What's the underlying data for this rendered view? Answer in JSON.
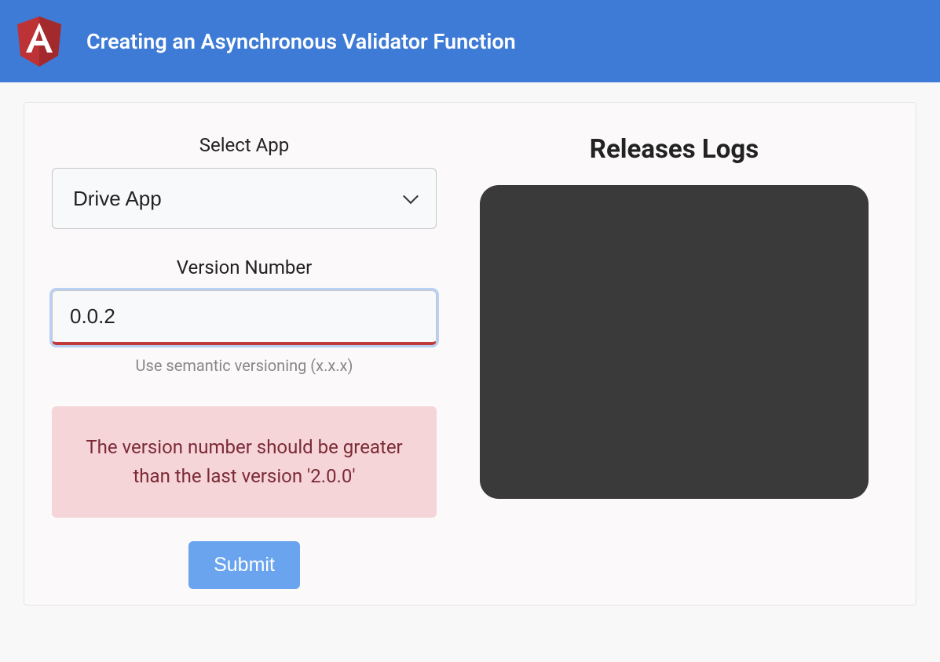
{
  "header": {
    "title": "Creating an Asynchronous Validator Function"
  },
  "form": {
    "select_label": "Select App",
    "select_value": "Drive App",
    "version_label": "Version Number",
    "version_value": "0.0.2",
    "version_hint": "Use semantic versioning (x.x.x)",
    "error_message": "The version number should be greater than the last version '2.0.0'",
    "submit_label": "Submit"
  },
  "logs": {
    "title": "Releases Logs"
  }
}
